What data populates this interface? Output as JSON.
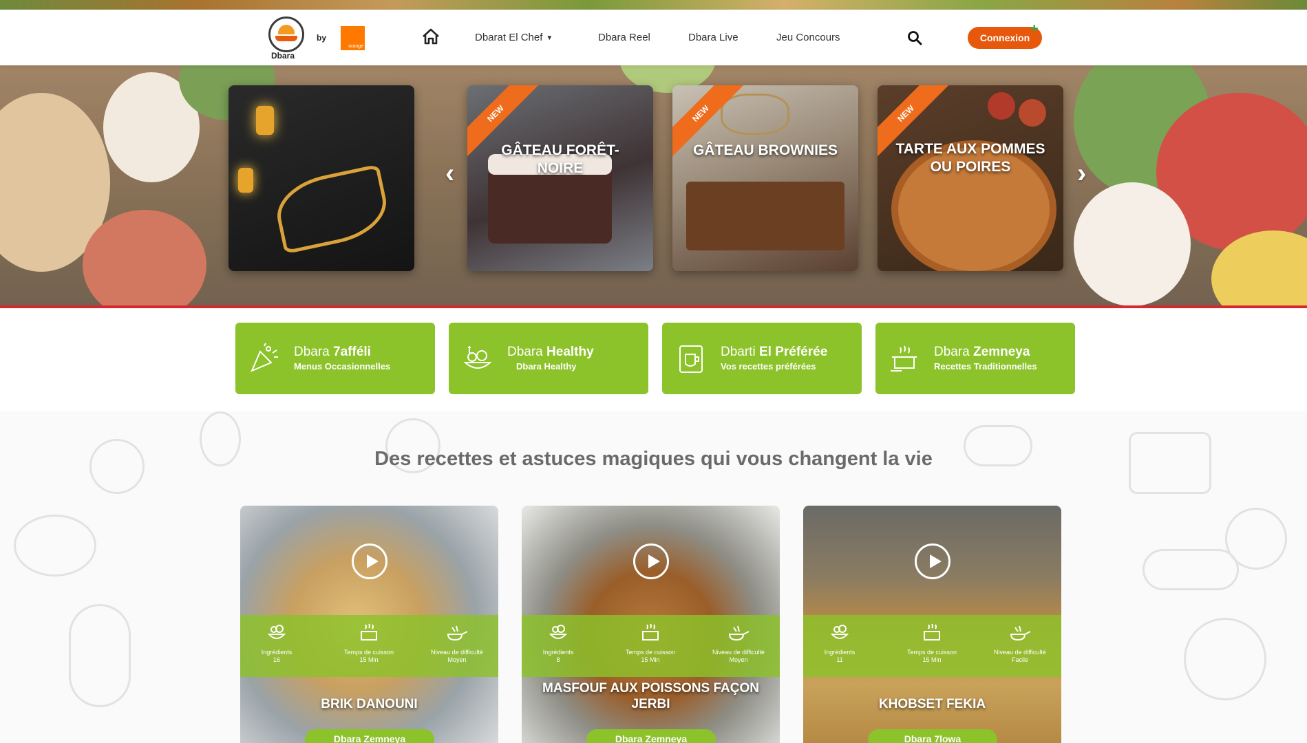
{
  "brand": {
    "logo_text": "Dbara",
    "by": "by",
    "partner_logo_text": "orange"
  },
  "nav": {
    "items": [
      {
        "label": "Dbarat El Chef",
        "has_dropdown": true
      },
      {
        "label": "Dbara Reel"
      },
      {
        "label": "Dbara Live"
      },
      {
        "label": "Jeu Concours"
      }
    ],
    "connexion": "Connexion",
    "connexion_badge": "+"
  },
  "colors": {
    "accent": "#e8580c",
    "green": "#8cc22a",
    "red_line": "#d7282f"
  },
  "carousel": {
    "prev_arrow": "‹",
    "next_arrow": "›",
    "slides": [
      {
        "title": "",
        "new": false,
        "theme": "ramadan"
      },
      {
        "title": "GÂTEAU FORÊT-NOIRE",
        "new": true,
        "badge": "NEW"
      },
      {
        "title": "GÂTEAU BROWNIES",
        "new": true,
        "badge": "NEW"
      },
      {
        "title": "TARTE AUX POMMES OU POIRES",
        "new": true,
        "badge": "NEW"
      }
    ]
  },
  "categories": [
    {
      "title_light": "Dbara ",
      "title_bold": "7afféli",
      "subtitle": "Menus Occasionnelles",
      "icon": "party-icon"
    },
    {
      "title_light": "Dbara ",
      "title_bold": "Healthy",
      "subtitle": "Dbara Healthy",
      "icon": "healthy-icon"
    },
    {
      "title_light": "Dbarti ",
      "title_bold": "El Préférée",
      "subtitle": "Vos recettes préférées",
      "icon": "favorite-icon"
    },
    {
      "title_light": "Dbara ",
      "title_bold": "Zemneya",
      "subtitle": "Recettes Traditionnelles",
      "icon": "pot-icon"
    }
  ],
  "section_title": "Des recettes et astuces magiques qui vous changent la vie",
  "recipes": [
    {
      "title": "BRIK DANOUNI",
      "pill": "Dbara Zemneya",
      "ingredients_label": "Ingrédients",
      "ingredients": "16",
      "time_label": "Temps de cuisson",
      "time": "15 Min",
      "level_label": "Niveau de difficulté",
      "level": "Moyen"
    },
    {
      "title": "MASFOUF AUX POISSONS FAÇON JERBI",
      "pill": "Dbara Zemneya",
      "ingredients_label": "Ingrédients",
      "ingredients": "8",
      "time_label": "Temps de cuisson",
      "time": "15 Min",
      "level_label": "Niveau de difficulté",
      "level": "Moyen"
    },
    {
      "title": "KHOBSET FEKIA",
      "pill": "Dbara 7lowa",
      "ingredients_label": "Ingrédients",
      "ingredients": "11",
      "time_label": "Temps de cuisson",
      "time": "15 Min",
      "level_label": "Niveau de difficulté",
      "level": "Facile"
    }
  ]
}
